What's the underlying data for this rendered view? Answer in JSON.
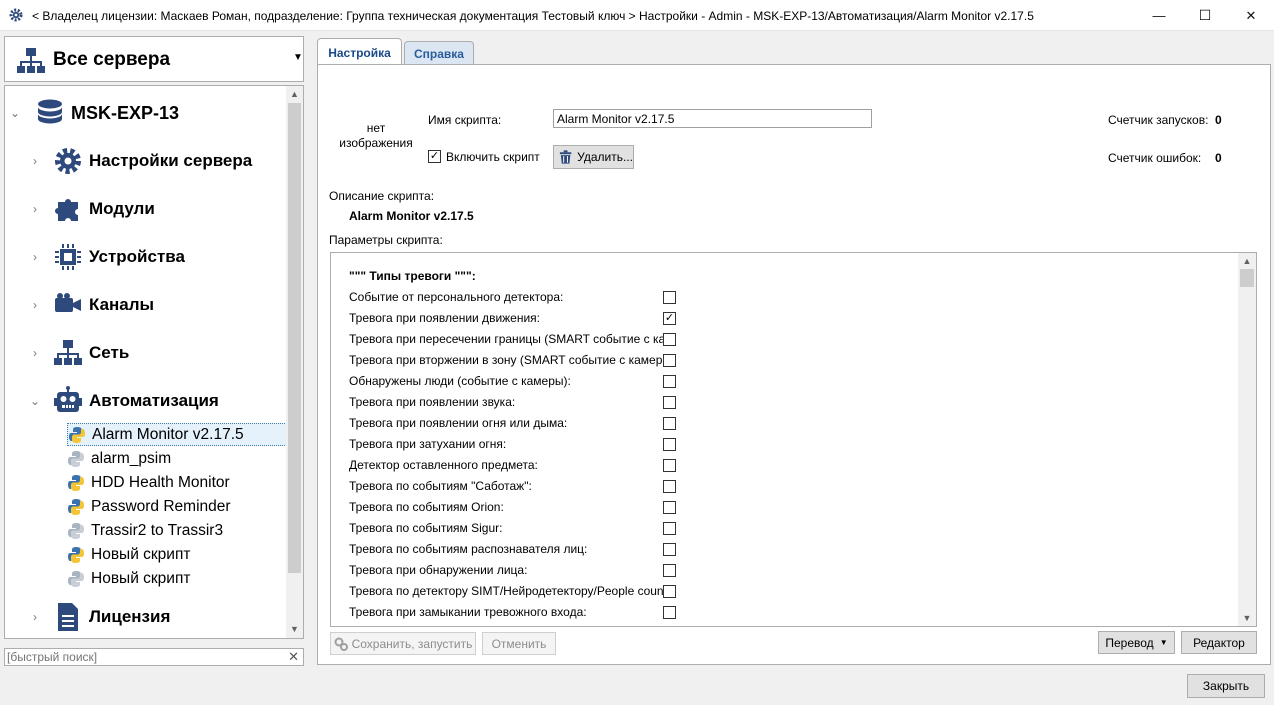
{
  "window": {
    "title": "< Владелец лицензии: Маскаев Роман, подразделение: Группа техническая документация Тестовый ключ > Настройки - Admin - MSK-EXP-13/Автоматизация/Alarm Monitor v2.17.5",
    "min_glyph": "—",
    "max_glyph": "☐",
    "close_glyph": "✕"
  },
  "sidebar": {
    "server_selector": "Все сервера",
    "tree": {
      "server": "MSK-EXP-13",
      "nodes": [
        {
          "label": "Настройки сервера",
          "icon": "gear-icon"
        },
        {
          "label": "Модули",
          "icon": "puzzle-icon"
        },
        {
          "label": "Устройства",
          "icon": "chip-icon"
        },
        {
          "label": "Каналы",
          "icon": "camera-icon"
        },
        {
          "label": "Сеть",
          "icon": "network-icon"
        },
        {
          "label": "Автоматизация",
          "icon": "robot-icon"
        }
      ],
      "scripts": [
        {
          "label": "Alarm Monitor v2.17.5",
          "selected": true,
          "enabled": true
        },
        {
          "label": "alarm_psim",
          "enabled": false
        },
        {
          "label": "HDD Health Monitor",
          "enabled": true
        },
        {
          "label": "Password Reminder",
          "enabled": true
        },
        {
          "label": "Trassir2 to Trassir3",
          "enabled": false
        },
        {
          "label": "Новый скрипт",
          "enabled": true
        },
        {
          "label": "Новый скрипт",
          "enabled": false
        }
      ],
      "license": "Лицензия"
    },
    "quick_search_placeholder": "[быстрый поиск]"
  },
  "tabs": [
    {
      "label": "Настройка",
      "active": true
    },
    {
      "label": "Справка",
      "active": false
    }
  ],
  "script": {
    "no_image": "нет изображения",
    "name_label": "Имя скрипта:",
    "name_value": "Alarm Monitor v2.17.5",
    "enable_label": "Включить скрипт",
    "enabled": true,
    "delete_button": "Удалить...",
    "run_counter_label": "Счетчик запусков:",
    "run_counter_value": "0",
    "error_counter_label": "Счетчик ошибок:",
    "error_counter_value": "0",
    "description_label": "Описание скрипта:",
    "description_value": "Alarm Monitor v2.17.5",
    "params_label": "Параметры скрипта:"
  },
  "params": {
    "section_header": "\"\"\" Типы тревоги \"\"\":",
    "rows": [
      {
        "label": "Событие от персонального детектора:",
        "checked": false
      },
      {
        "label": "Тревога при появлении движения:",
        "checked": true
      },
      {
        "label": "Тревога при пересечении границы (SMART событие с камеры):",
        "checked": false
      },
      {
        "label": "Тревога при вторжении в зону (SMART событие с камеры):",
        "checked": false
      },
      {
        "label": "Обнаружены люди (событие с камеры):",
        "checked": false
      },
      {
        "label": "Тревога при появлении звука:",
        "checked": false
      },
      {
        "label": "Тревога при появлении огня или дыма:",
        "checked": false
      },
      {
        "label": "Тревога при затухании огня:",
        "checked": false
      },
      {
        "label": "Детектор оставленного предмета:",
        "checked": false
      },
      {
        "label": "Тревога по событиям \"Саботаж\":",
        "checked": false
      },
      {
        "label": "Тревога по событиям Orion:",
        "checked": false
      },
      {
        "label": "Тревога по событиям Sigur:",
        "checked": false
      },
      {
        "label": "Тревога по событиям распознавателя лиц:",
        "checked": false
      },
      {
        "label": "Тревога при обнаружении лица:",
        "checked": false
      },
      {
        "label": "Тревога по детектору SIMT/Нейродетектору/People counter:",
        "checked": false
      },
      {
        "label": "Тревога при замыкании тревожного входа:",
        "checked": false
      }
    ]
  },
  "footer": {
    "save_run": "Сохранить, запустить",
    "cancel": "Отменить",
    "translate": "Перевод",
    "editor": "Редактор",
    "close": "Закрыть"
  },
  "colors": {
    "tree_icon": "#2e4a7d",
    "selection": "#e5f1fb",
    "tab_text": "#2a5d9b"
  }
}
